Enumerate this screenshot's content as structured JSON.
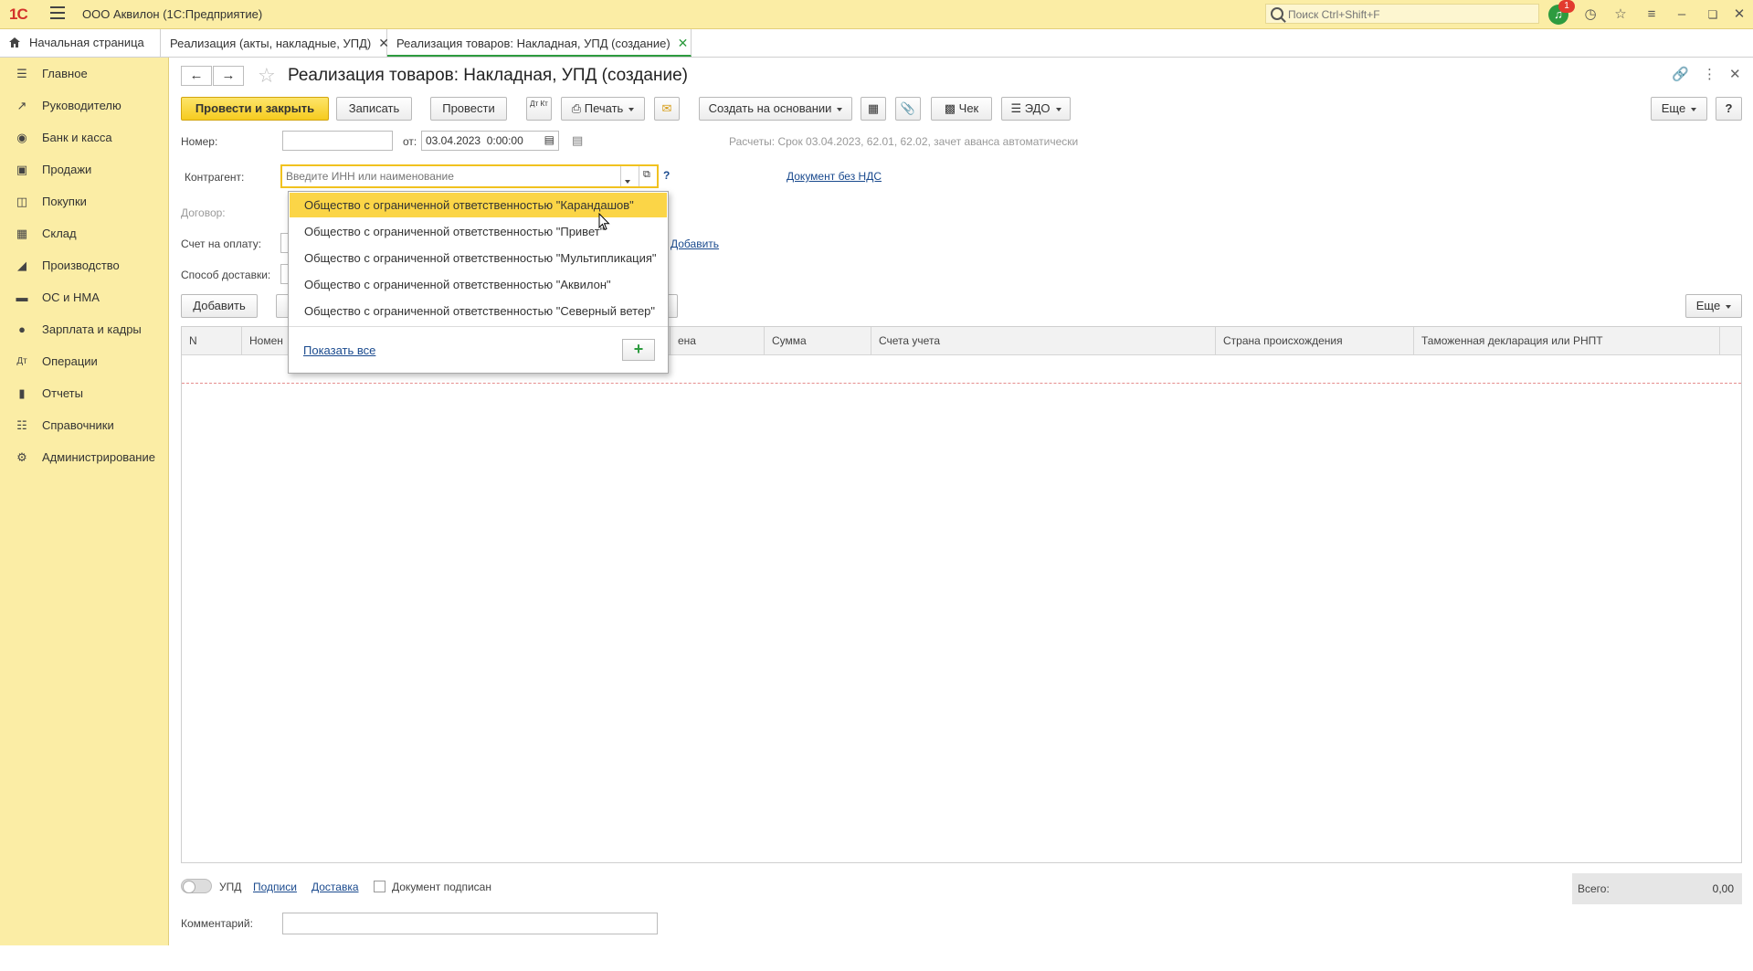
{
  "app": {
    "logo": "1С",
    "title": "ООО Аквилон  (1С:Предприятие)",
    "search_placeholder": "Поиск Ctrl+Shift+F",
    "notifications": "1"
  },
  "tabs": [
    {
      "label": "Начальная страница"
    },
    {
      "label": "Реализация (акты, накладные, УПД)"
    },
    {
      "label": "Реализация товаров: Накладная, УПД (создание)"
    }
  ],
  "sidebar": {
    "items": [
      {
        "label": "Главное",
        "icon": "menu-icon"
      },
      {
        "label": "Руководителю",
        "icon": "trend-icon"
      },
      {
        "label": "Банк и касса",
        "icon": "coin-icon"
      },
      {
        "label": "Продажи",
        "icon": "bag-icon"
      },
      {
        "label": "Покупки",
        "icon": "cart-icon"
      },
      {
        "label": "Склад",
        "icon": "warehouse-icon"
      },
      {
        "label": "Производство",
        "icon": "factory-icon"
      },
      {
        "label": "ОС и НМА",
        "icon": "truck-icon"
      },
      {
        "label": "Зарплата и кадры",
        "icon": "person-icon"
      },
      {
        "label": "Операции",
        "icon": "operations-icon"
      },
      {
        "label": "Отчеты",
        "icon": "chart-icon"
      },
      {
        "label": "Справочники",
        "icon": "books-icon"
      },
      {
        "label": "Администрирование",
        "icon": "gear-icon"
      }
    ]
  },
  "form": {
    "title": "Реализация товаров: Накладная, УПД (создание)",
    "toolbar": {
      "post_close": "Провести и закрыть",
      "save": "Записать",
      "post": "Провести",
      "dtkt": "Дт Кт",
      "print": "Печать",
      "create_based": "Создать на основании",
      "check": "Чек",
      "edo": "ЭДО",
      "more": "Еще",
      "help": "?"
    },
    "number_label": "Номер:",
    "number_value": "",
    "date_label": "от:",
    "date_value": "03.04.2023  0:00:00",
    "settlements": "Расчеты: Срок 03.04.2023, 62.01, 62.02, зачет аванса автоматически",
    "counterparty_label": "Контрагент:",
    "counterparty_placeholder": "Введите ИНН или наименование",
    "help_q": "?",
    "no_vat_link": "Документ без НДС",
    "contract_label": "Договор:",
    "invoice_label": "Счет на оплату:",
    "add_link": "Добавить",
    "delivery_label": "Способ доставки:",
    "table_add": "Добавить",
    "table_more": "Еще",
    "columns": [
      "N",
      "Номен",
      "ена",
      "Сумма",
      "Счета учета",
      "Страна происхождения",
      "Таможенная декларация или РНПТ"
    ]
  },
  "dropdown": {
    "items": [
      "Общество с ограниченной ответственностью \"Карандашов\"",
      "Общество с ограниченной ответственностью \"Привет\"",
      "Общество с ограниченной ответственностью \"Мультипликация\"",
      "Общество с ограниченной ответственностью \"Аквилон\"",
      "Общество с ограниченной ответственностью \"Северный ветер\""
    ],
    "selected_index": 0,
    "show_all": "Показать все",
    "add": "+"
  },
  "footer": {
    "upd_label": "УПД",
    "signatures_link": "Подписи",
    "delivery_link": "Доставка",
    "signed_label": "Документ подписан",
    "total_label": "Всего:",
    "total_value": "0,00",
    "comment_label": "Комментарий:",
    "comment_value": ""
  },
  "colors": {
    "accent_yellow": "#fbeda5",
    "primary_button": "#f6cb1f",
    "green": "#2d9b3f",
    "selection": "#fbd547"
  }
}
